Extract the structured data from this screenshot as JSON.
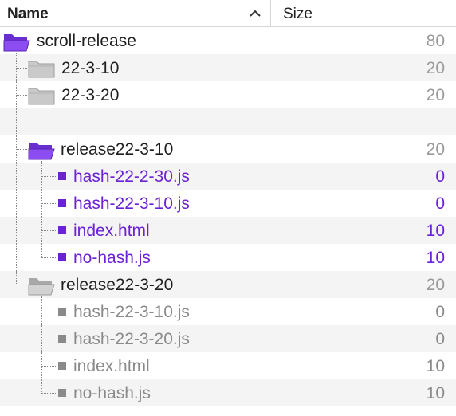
{
  "header": {
    "name_label": "Name",
    "size_label": "Size",
    "sort_icon": "chevron-up-icon"
  },
  "colors": {
    "purple": "#6b22d6",
    "gray_text": "#8a8a8a",
    "folder_purple": "#7b3fe4",
    "folder_gray": "#c9c9c9"
  },
  "tree": [
    {
      "label": "scroll-release",
      "size": "80",
      "type": "folder-open",
      "color": "purple"
    },
    {
      "label": "22-3-10",
      "size": "20",
      "type": "folder-closed",
      "color": "gray"
    },
    {
      "label": "22-3-20",
      "size": "20",
      "type": "folder-closed",
      "color": "gray"
    },
    {
      "label": "",
      "size": "",
      "type": "spacer"
    },
    {
      "label": "release22-3-10",
      "size": "20",
      "type": "folder-open",
      "color": "purple"
    },
    {
      "label": "hash-22-2-30.js",
      "size": "0",
      "type": "file",
      "color": "purple"
    },
    {
      "label": "hash-22-3-10.js",
      "size": "0",
      "type": "file",
      "color": "purple"
    },
    {
      "label": "index.html",
      "size": "10",
      "type": "file",
      "color": "purple"
    },
    {
      "label": "no-hash.js",
      "size": "10",
      "type": "file",
      "color": "purple"
    },
    {
      "label": "release22-3-20",
      "size": "20",
      "type": "folder-open",
      "color": "gray"
    },
    {
      "label": "hash-22-3-10.js",
      "size": "0",
      "type": "file",
      "color": "gray"
    },
    {
      "label": "hash-22-3-20.js",
      "size": "0",
      "type": "file",
      "color": "gray"
    },
    {
      "label": "index.html",
      "size": "10",
      "type": "file",
      "color": "gray"
    },
    {
      "label": "no-hash.js",
      "size": "10",
      "type": "file",
      "color": "gray"
    }
  ]
}
